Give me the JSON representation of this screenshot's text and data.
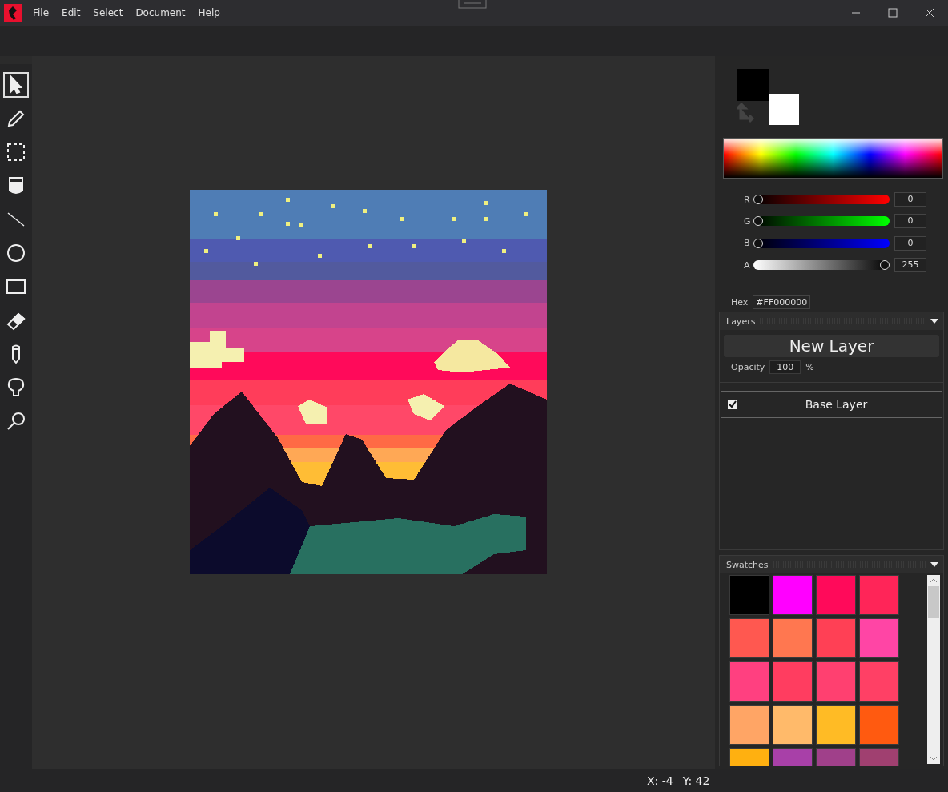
{
  "menu": [
    "File",
    "Edit",
    "Select",
    "Document",
    "Help"
  ],
  "tools": [
    {
      "kind": "pointer",
      "selected": true
    },
    {
      "kind": "pencil",
      "selected": false
    },
    {
      "kind": "selection",
      "selected": false
    },
    {
      "kind": "bucket",
      "selected": false
    },
    {
      "kind": "line",
      "selected": false
    },
    {
      "kind": "ellipse",
      "selected": false
    },
    {
      "kind": "rectangle",
      "selected": false
    },
    {
      "kind": "eraser",
      "selected": false
    },
    {
      "kind": "pen",
      "selected": false
    },
    {
      "kind": "shape",
      "selected": false
    },
    {
      "kind": "zoom",
      "selected": false
    }
  ],
  "colors": [
    {
      "kind": "primary",
      "color": "#000000"
    },
    {
      "kind": "secondary",
      "color": "#ffffff"
    }
  ],
  "channels": [
    {
      "label": "R",
      "kind": "red",
      "level": 0,
      "value": "0"
    },
    {
      "label": "G",
      "kind": "green",
      "level": 0,
      "value": "0"
    },
    {
      "label": "B",
      "kind": "blue",
      "level": 0,
      "value": "0"
    },
    {
      "label": "A",
      "kind": "alpha",
      "level": 1,
      "value": "255"
    }
  ],
  "hex": {
    "label": "Hex",
    "value": "#FF000000"
  },
  "layers": {
    "title": "Layers",
    "new_button": "New Layer",
    "opacity_label": "Opacity",
    "opacity": "100",
    "opacity_unit": "%",
    "items": [
      {
        "name": "Base Layer",
        "visible": true
      }
    ]
  },
  "swatches": {
    "title": "Swatches",
    "items": [
      {
        "color": "#000000"
      },
      {
        "color": "#ff00ff"
      },
      {
        "color": "#ff0a5a"
      },
      {
        "color": "#ff2558"
      },
      {
        "color": "#ff5850"
      },
      {
        "color": "#ff7750"
      },
      {
        "color": "#ff4055"
      },
      {
        "color": "#ff45a5"
      },
      {
        "color": "#ff4080"
      },
      {
        "color": "#ff3d60"
      },
      {
        "color": "#ff4070"
      },
      {
        "color": "#ff4065"
      },
      {
        "color": "#ffa565"
      },
      {
        "color": "#ffba6a"
      },
      {
        "color": "#ffbb25"
      },
      {
        "color": "#ff5a10"
      },
      {
        "color": "#ffb010"
      },
      {
        "color": "#a840a8"
      },
      {
        "color": "#a0408a"
      },
      {
        "color": "#a04070"
      }
    ]
  },
  "status": {
    "x": "X: -4",
    "y": "Y: 42"
  }
}
